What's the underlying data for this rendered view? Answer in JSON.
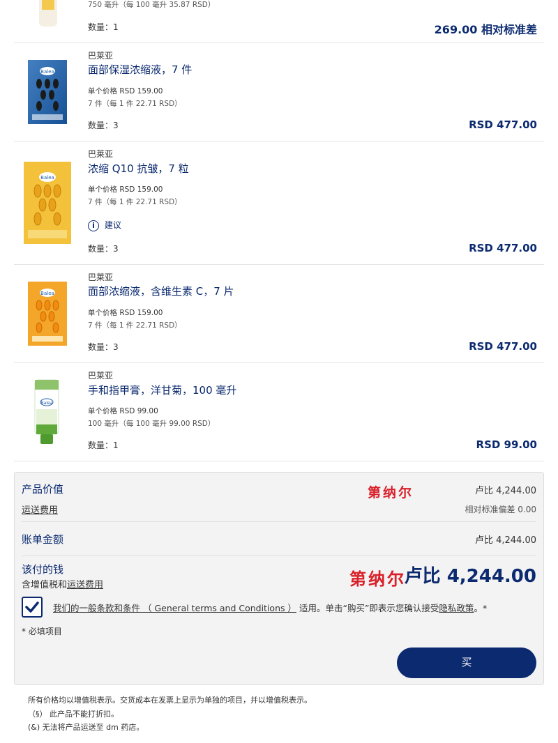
{
  "item0": {
    "per_unit": "750 毫升（每 100 毫升 35.87 RSD）",
    "qty": "数量：1",
    "total": "269.00 相对标准差"
  },
  "items": [
    {
      "brand": "巴莱亚",
      "name": "面部保湿浓缩液，7 件",
      "unit_price": "单个价格 RSD 159.00",
      "per_unit": "7 件（每 1 件 22.71 RSD）",
      "qty": "数量：3",
      "total": "RSD 477.00"
    },
    {
      "brand": "巴莱亚",
      "name": "浓缩 Q10 抗皱，7 粒",
      "unit_price": "单个价格 RSD 159.00",
      "per_unit": "7 件（每 1 件 22.71 RSD）",
      "advice": "建议",
      "qty": "数量：3",
      "total": "RSD 477.00"
    },
    {
      "brand": "巴莱亚",
      "name": "面部浓缩液，含维生素 C，7 片",
      "unit_price": "单个价格 RSD 159.00",
      "per_unit": "7 件（每 1 件 22.71 RSD）",
      "qty": "数量：3",
      "total": "RSD 477.00"
    },
    {
      "brand": "巴莱亚",
      "name": "手和指甲膏，洋甘菊，100 毫升",
      "unit_price": "单个价格 RSD 99.00",
      "per_unit": "100 毫升（每 100 毫升 99.00 RSD）",
      "qty": "数量：1",
      "total": "RSD 99.00"
    }
  ],
  "summary": {
    "product_value_label": "产品价值",
    "product_value": "卢比 4,244.00",
    "shipping_label": "运送费用",
    "shipping_value": "相对标准偏差 0.00",
    "stamp1": "第纳尔",
    "invoice_label": "账单金额",
    "invoice_value": "卢比 4,244.00",
    "to_pay_label": "该付的钱",
    "vat_prefix": "含增值税和",
    "vat_link": "运送费用",
    "stamp2": "第纳尔",
    "grand_total": "卢比 4,244.00",
    "terms_pre": "我们的一般条款和条件 （ General terms and Conditions ）",
    "terms_mid": "适用。单击“购买”即表示您确认接受",
    "terms_link": "隐私政策",
    "terms_post": "。*",
    "required": "* 必填项目",
    "buy_label": "买"
  },
  "footer": {
    "line1": "所有价格均以增值税表示。交货成本在发票上显示为单独的项目，并以增值税表示。",
    "line2": "（§） 此产品不能打折扣。",
    "line3": "(&) 无法将产品运送至 dm 药店。"
  },
  "colors": {
    "brand_blue": "#0b2a6f",
    "stamp_red": "#d9202a"
  }
}
